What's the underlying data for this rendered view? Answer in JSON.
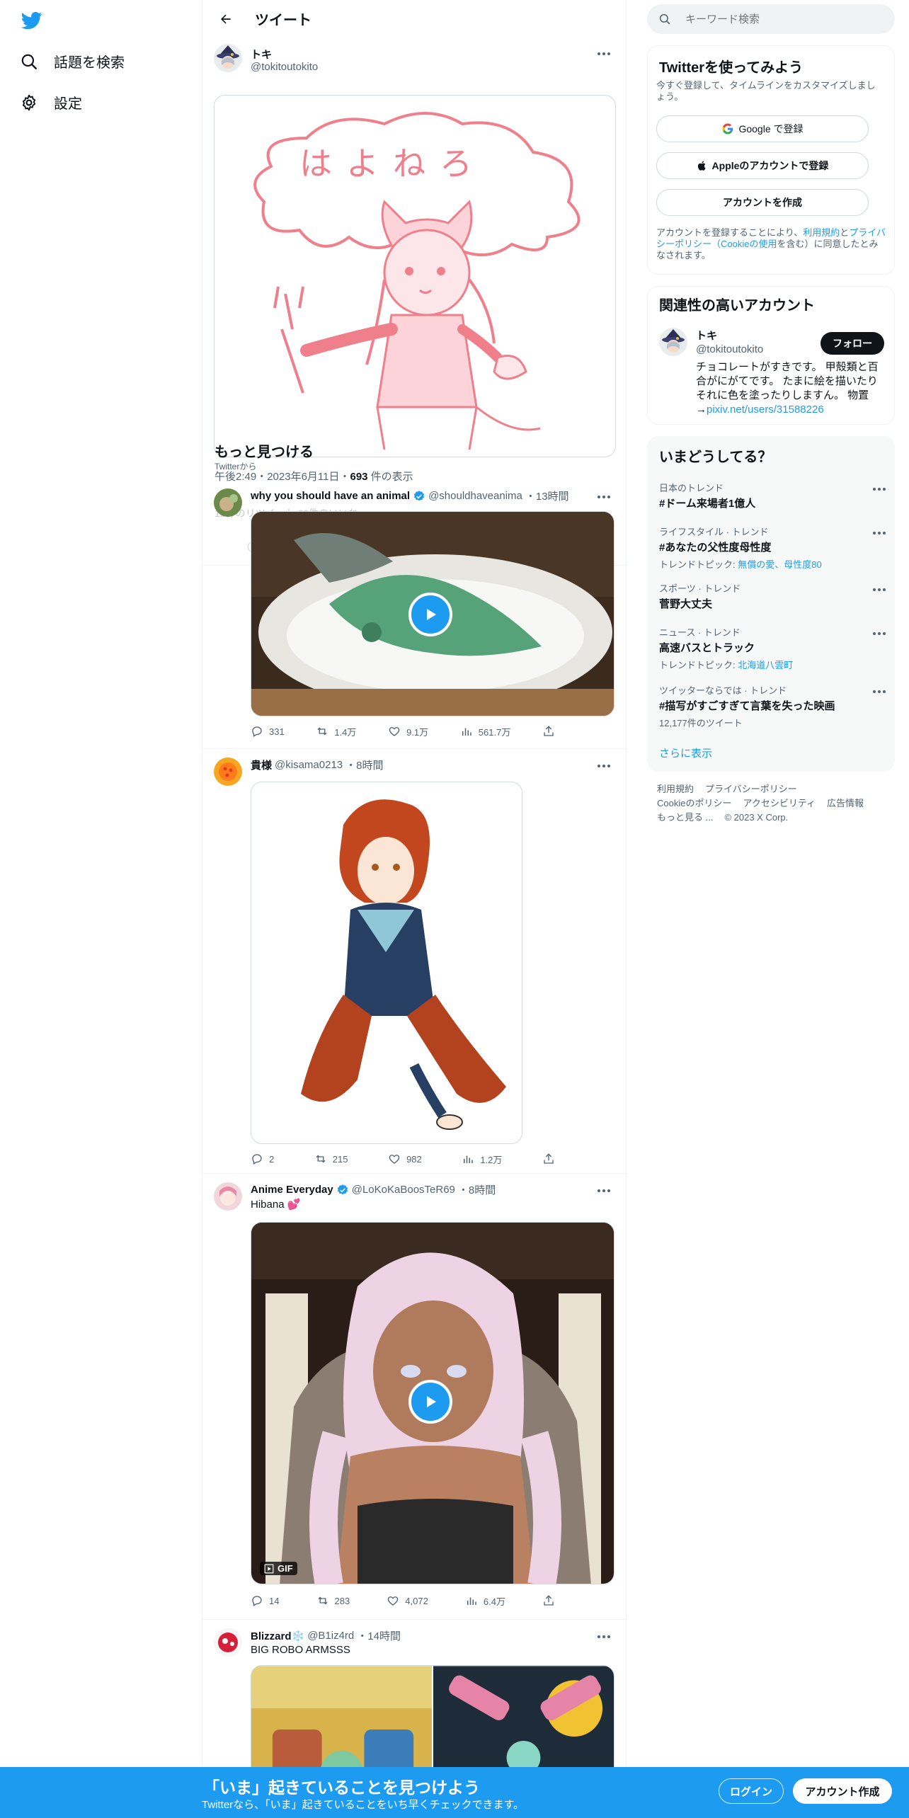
{
  "nav": {
    "explore_label": "話題を検索",
    "settings_label": "設定"
  },
  "header": {
    "title": "ツイート"
  },
  "main_tweet": {
    "name": "トキ",
    "handle": "@tokitoutokito",
    "image_text": "はよねろ",
    "discover_heading": "もっと見つける",
    "source": "Twitterから",
    "time": "午後2:49・2023年6月11日・",
    "views_count": "693",
    "views_label": " 件の表示",
    "overlap_text": "18件のリツイート   60件のいいね",
    "overlap_icon": "◯"
  },
  "feed": [
    {
      "name": "why you should have an animal",
      "handle": "@shouldhaveanima",
      "time": "・13時間",
      "replies": "331",
      "retweets": "1.4万",
      "likes": "9.1万",
      "views": "561.7万"
    },
    {
      "name": "貴様",
      "handle": "@kisama0213",
      "time": "・8時間",
      "replies": "2",
      "retweets": "215",
      "likes": "982",
      "views": "1.2万"
    },
    {
      "name": "Anime Everyday",
      "handle": "@LoKoKaBoosTeR69",
      "time": "・8時間",
      "text": "Hibana 💕",
      "gif_label": "GIF",
      "replies": "14",
      "retweets": "283",
      "likes": "4,072",
      "views": "6.4万"
    },
    {
      "name": "Blizzard❄️",
      "handle": "@B1iz4rd",
      "time": "・14時間",
      "text": "BIG ROBO ARMSSS"
    }
  ],
  "search": {
    "placeholder": "キーワード検索"
  },
  "signup_card": {
    "title": "Twitterを使ってみよう",
    "subtitle": "今すぐ登録して、タイムラインをカスタマイズしましょう。",
    "google": "Google で登録",
    "apple": "Appleのアカウントで登録",
    "create": "アカウントを作成",
    "terms_1": "アカウントを登録することにより、",
    "terms_link1": "利用規約",
    "terms_2": "と",
    "terms_link2": "プライバシーポリシー（Cookieの使用",
    "terms_3": "を含む）に同意したとみなされます。"
  },
  "related": {
    "title": "関連性の高いアカウント",
    "name": "トキ",
    "handle": "@tokitoutokito",
    "follow": "フォロー",
    "bio": "チョコレートがすきです。 甲殻類と百合がにがてです。 たまに絵を描いたりそれに色を塗ったりしますん。 物置→",
    "bio_link": "pixiv.net/users/31588226"
  },
  "trends": {
    "title": "いまどうしてる？",
    "items": [
      {
        "cat": "日本のトレンド",
        "title": "#ドーム来場者1億人",
        "sub": ""
      },
      {
        "cat": "ライフスタイル · トレンド",
        "title": "#あなたの父性度母性度",
        "sub_label": "トレンドトピック: ",
        "sub_link": "無償の愛、母性度80"
      },
      {
        "cat": "スポーツ · トレンド",
        "title": "菅野大丈夫",
        "sub": ""
      },
      {
        "cat": "ニュース · トレンド",
        "title": "高速バスとトラック",
        "sub_label": "トレンドトピック: ",
        "sub_link": "北海道八雲町"
      },
      {
        "cat": "ツイッターならでは · トレンド",
        "title": "#描写がすごすぎて言葉を失った映画",
        "sub": "12,177件のツイート"
      }
    ],
    "show_more": "さらに表示"
  },
  "footer": {
    "terms": "利用規約",
    "privacy": "プライバシーポリシー",
    "cookie": "Cookieのポリシー",
    "accessibility": "アクセシビリティ",
    "ads": "広告情報",
    "more": "もっと見る ...",
    "copyright": "© 2023 X Corp."
  },
  "banner": {
    "headline": "「いま」起きていることを見つけよう",
    "sub": "Twitterなら、「いま」起きていることをいち早くチェックできます。",
    "login": "ログイン",
    "signup": "アカウント作成"
  },
  "colors": {
    "accent": "#1d9bf0",
    "text": "#0f1419",
    "muted": "#536471"
  }
}
